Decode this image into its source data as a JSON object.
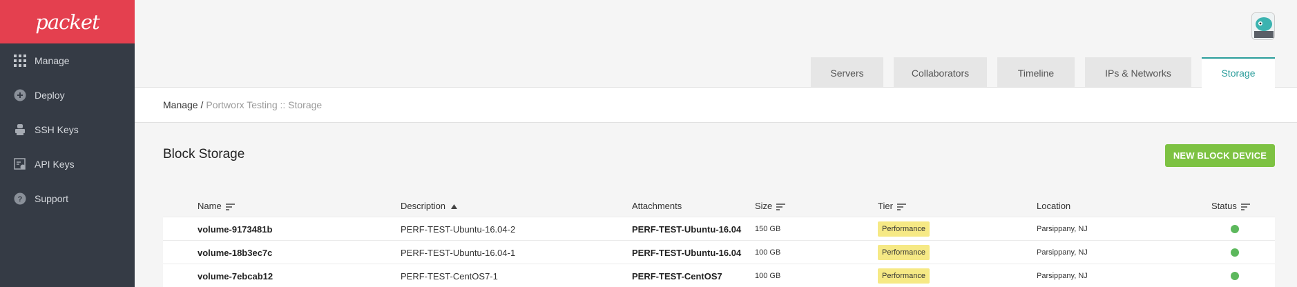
{
  "brand": {
    "logo_text": "packet"
  },
  "sidebar": {
    "items": [
      {
        "label": "Manage",
        "icon": "grid-icon"
      },
      {
        "label": "Deploy",
        "icon": "plus-circle-icon"
      },
      {
        "label": "SSH Keys",
        "icon": "key-icon"
      },
      {
        "label": "API Keys",
        "icon": "api-key-icon"
      },
      {
        "label": "Support",
        "icon": "help-circle-icon"
      }
    ]
  },
  "tabs": [
    {
      "label": "Servers"
    },
    {
      "label": "Collaborators"
    },
    {
      "label": "Timeline"
    },
    {
      "label": "IPs & Networks"
    },
    {
      "label": "Storage",
      "active": true
    }
  ],
  "breadcrumb": {
    "root": "Manage /",
    "current": "Portworx Testing :: Storage"
  },
  "page": {
    "title": "Block Storage",
    "new_button": "NEW BLOCK DEVICE"
  },
  "table": {
    "headers": {
      "name": "Name",
      "description": "Description",
      "attachments": "Attachments",
      "size": "Size",
      "tier": "Tier",
      "location": "Location",
      "status": "Status"
    },
    "rows": [
      {
        "name": "volume-9173481b",
        "description": "PERF-TEST-Ubuntu-16.04-2",
        "attachments": "PERF-TEST-Ubuntu-16.04",
        "size": "150 GB",
        "tier": "Performance",
        "location": "Parsippany, NJ",
        "status": "active"
      },
      {
        "name": "volume-18b3ec7c",
        "description": "PERF-TEST-Ubuntu-16.04-1",
        "attachments": "PERF-TEST-Ubuntu-16.04",
        "size": "100 GB",
        "tier": "Performance",
        "location": "Parsippany, NJ",
        "status": "active"
      },
      {
        "name": "volume-7ebcab12",
        "description": "PERF-TEST-CentOS7-1",
        "attachments": "PERF-TEST-CentOS7",
        "size": "100 GB",
        "tier": "Performance",
        "location": "Parsippany, NJ",
        "status": "active"
      }
    ]
  },
  "colors": {
    "brand_red": "#e4404f",
    "sidebar_bg": "#353b45",
    "accent_teal": "#2a9d9b",
    "button_green": "#7dc242",
    "tier_yellow": "#f6e985",
    "status_green": "#5cb85c"
  }
}
